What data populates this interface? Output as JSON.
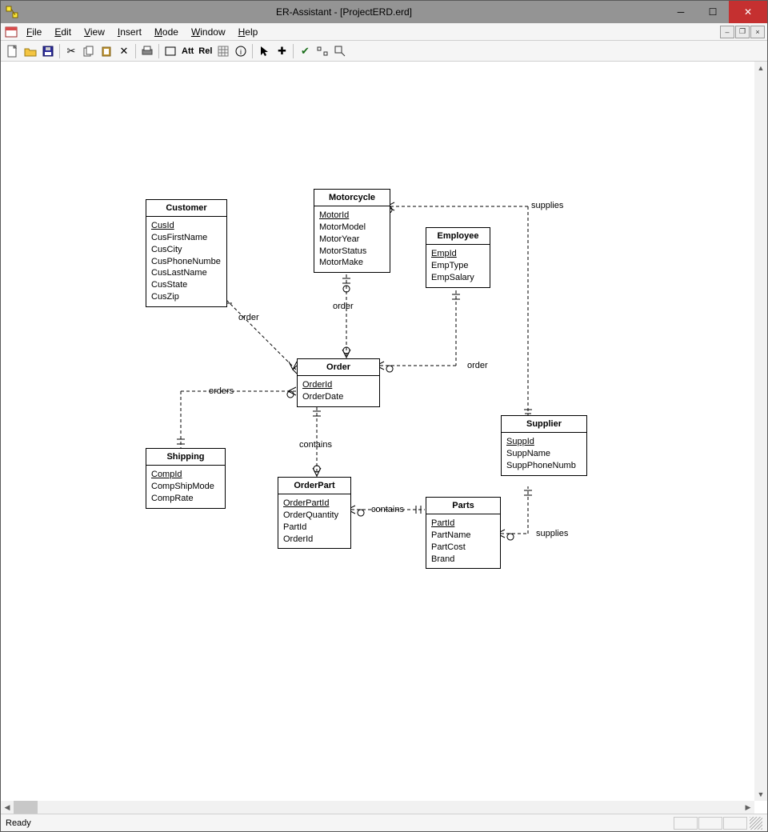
{
  "app": {
    "title": "ER-Assistant - [ProjectERD.erd]"
  },
  "menus": {
    "file": "File",
    "edit": "Edit",
    "view": "View",
    "insert": "Insert",
    "mode": "Mode",
    "window": "Window",
    "help": "Help"
  },
  "toolbar": {
    "att": "Att",
    "rel": "Rel"
  },
  "status": {
    "ready": "Ready"
  },
  "entities": {
    "customer": {
      "title": "Customer",
      "attrs": [
        "CusId",
        "CusFirstName",
        "CusCity",
        "CusPhoneNumbe",
        "CusLastName",
        "CusState",
        "CusZip"
      ],
      "pk": 0
    },
    "motorcycle": {
      "title": "Motorcycle",
      "attrs": [
        "MotorId",
        "MotorModel",
        "MotorYear",
        "MotorStatus",
        "MotorMake"
      ],
      "pk": 0
    },
    "employee": {
      "title": "Employee",
      "attrs": [
        "EmpId",
        "EmpType",
        "EmpSalary"
      ],
      "pk": 0
    },
    "order": {
      "title": "Order",
      "attrs": [
        "OrderId",
        "OrderDate"
      ],
      "pk": 0
    },
    "shipping": {
      "title": "Shipping",
      "attrs": [
        "CompId",
        "CompShipMode",
        "CompRate"
      ],
      "pk": 0
    },
    "orderpart": {
      "title": "OrderPart",
      "attrs": [
        "OrderPartId",
        "OrderQuantity",
        "PartId",
        "OrderId"
      ],
      "pk": 0
    },
    "parts": {
      "title": "Parts",
      "attrs": [
        "PartId",
        "PartName",
        "PartCost",
        "Brand"
      ],
      "pk": 0
    },
    "supplier": {
      "title": "Supplier",
      "attrs": [
        "SuppId",
        "SuppName",
        "SuppPhoneNumb"
      ],
      "pk": 0
    }
  },
  "relations": {
    "r1": "order",
    "r2": "order",
    "r3": "order",
    "r4": "orders",
    "r5": "contains",
    "r6": "contains",
    "r7": "supplies",
    "r8": "supplies"
  }
}
